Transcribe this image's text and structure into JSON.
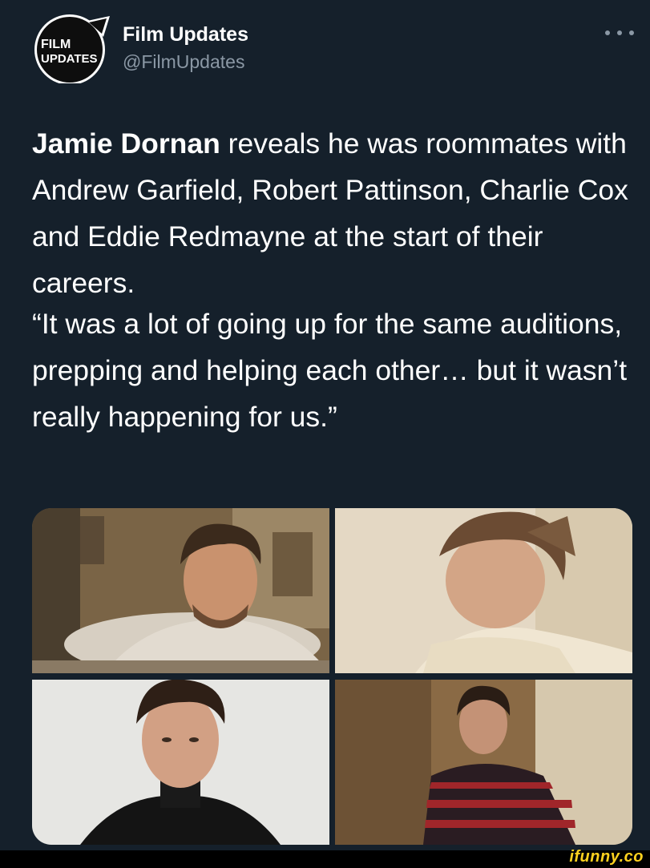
{
  "author": {
    "display_name": "Film Updates",
    "handle": "@FilmUpdates",
    "avatar_text_top": "FILM",
    "avatar_text_bottom": "UPDATES"
  },
  "tweet": {
    "bold_lead": "Jamie Dornan",
    "rest": " reveals he was roommates with Andrew Garfield, Robert Pattinson, Charlie Cox and Eddie Redmayne at the start of their careers.",
    "quote": "“It was a lot of going up for the same auditions, prepping and helping each other… but it wasn’t really happening for us.”"
  },
  "photos": [
    {
      "icon": "portrait-photo",
      "subject": "man-leaning-on-table"
    },
    {
      "icon": "portrait-photo",
      "subject": "man-reclining"
    },
    {
      "icon": "portrait-photo",
      "subject": "man-in-turtleneck"
    },
    {
      "icon": "portrait-photo",
      "subject": "man-in-striped-sweater"
    }
  ],
  "watermark": "ifunny.co",
  "colors": {
    "background": "#15202b",
    "text": "#ffffff",
    "secondary_text": "#8b98a5",
    "watermark": "#ffd21f"
  }
}
